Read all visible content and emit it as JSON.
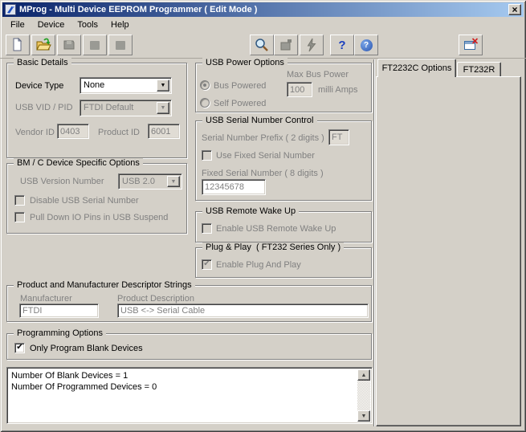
{
  "window": {
    "title": "MProg - Multi Device EEPROM Programmer ( Edit Mode )",
    "close_glyph": "×"
  },
  "menu": {
    "items": [
      "File",
      "Device",
      "Tools",
      "Help"
    ]
  },
  "toolbar": {
    "help_glyph": "?",
    "about_glyph": "?"
  },
  "basic_details": {
    "title": "Basic Details",
    "device_type_label": "Device Type",
    "device_type_value": "None",
    "vid_pid_label": "USB VID / PID",
    "vid_pid_value": "FTDI Default",
    "vendor_id_label": "Vendor ID",
    "vendor_id_value": "0403",
    "product_id_label": "Product ID",
    "product_id_value": "6001"
  },
  "bmc_options": {
    "title": "BM / C Device Specific Options",
    "usb_version_label": "USB Version Number",
    "usb_version_value": "USB 2.0",
    "disable_serial_label": "Disable USB Serial Number",
    "pulldown_label": "Pull Down IO Pins in USB Suspend"
  },
  "usb_power": {
    "title": "USB Power Options",
    "bus_powered_label": "Bus Powered",
    "self_powered_label": "Self Powered",
    "max_bus_power_label": "Max Bus Power",
    "max_bus_power_value": "100",
    "milli_amps_label": "milli Amps"
  },
  "usb_serial": {
    "title": "USB Serial Number Control",
    "prefix_label": "Serial Number Prefix ( 2 digits )",
    "prefix_value": "FT",
    "use_fixed_label": "Use Fixed Serial Number",
    "fixed_label": "Fixed Serial Number ( 8 digits )",
    "fixed_value": "12345678"
  },
  "remote_wakeup": {
    "title": "USB Remote Wake Up",
    "enable_label": "Enable USB Remote Wake Up"
  },
  "plug_play": {
    "title": "Plug & Play  ( FT232 Series Only )",
    "enable_label": "Enable Plug And Play"
  },
  "descriptors": {
    "title": "Product and Manufacturer Descriptor Strings",
    "manufacturer_label": "Manufacturer",
    "manufacturer_value": "FTDI",
    "product_desc_label": "Product Description",
    "product_desc_value": "USB <-> Serial Cable"
  },
  "programming": {
    "title": "Programming Options",
    "only_blank_label": "Only Program Blank Devices"
  },
  "status": {
    "lines": [
      "Number Of Blank Devices = 1",
      "Number Of Programmed Devices = 0"
    ]
  },
  "tabs": {
    "active": "FT2232C Options",
    "inactive": "FT232R"
  },
  "glyphs": {
    "dropdown": "▼",
    "check": "✔",
    "scroll_up": "▲",
    "scroll_down": "▼"
  },
  "colors": {
    "titlebar_left": "#0a246a",
    "titlebar_right": "#a6caf0",
    "face": "#d4d0c8",
    "disabled_text": "#808080",
    "disabled_field_bg": "#e0dcd4",
    "field_bg": "#ffffff"
  }
}
